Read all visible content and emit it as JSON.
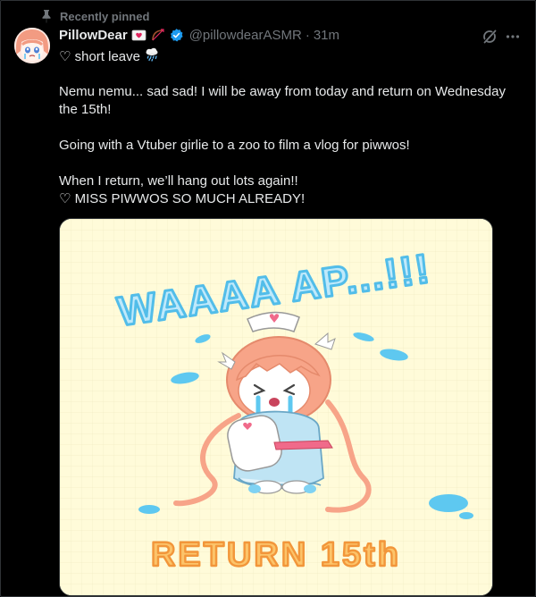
{
  "pinned": {
    "label": "Recently pinned"
  },
  "author": {
    "display_name": "PillowDear",
    "handle": "@pillowdearASMR",
    "separator": "·",
    "time": "31m"
  },
  "tweet": {
    "subtitle": "♡ short leave",
    "paragraphs": [
      "Nemu nemu... sad sad! I will be away from today and return on Wednesday the 15th!",
      "Going with a Vtuber girlie to a zoo to film a vlog for piwwos!",
      "When I return, we’ll hang out lots again!!",
      "♡ MISS PIWWOS SO MUCH ALREADY!"
    ]
  },
  "media": {
    "top_text": "WAAAA AP...!!!",
    "bottom_text": "RETURN 15th"
  },
  "colors": {
    "background": "#000000",
    "text": "#e7e9ea",
    "muted": "#71767b",
    "verified": "#1d9bf0",
    "image_bg": "#fffbd9",
    "image_blue": "#5ec8f0",
    "image_orange": "#f6a84a",
    "hair_pink": "#f7a488"
  },
  "icons": {
    "pin": "pin-icon",
    "verified": "verified-badge-icon",
    "grok": "grok-icon",
    "more": "more-dots-icon",
    "rain_cloud": "rain-cloud-icon"
  }
}
